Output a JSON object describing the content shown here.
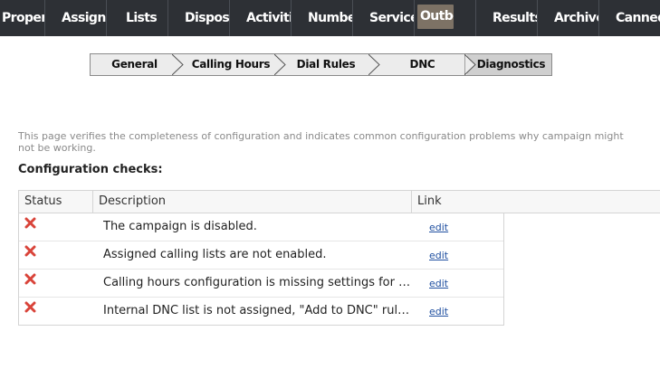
{
  "nav": {
    "tabs": [
      {
        "label": "Proper"
      },
      {
        "label": "Assignment"
      },
      {
        "label": "Lists"
      },
      {
        "label": "Dispositions"
      },
      {
        "label": "Activities"
      },
      {
        "label": "Numbers"
      },
      {
        "label": "Services"
      },
      {
        "label": "Outbound",
        "active": true
      },
      {
        "label": "Results"
      },
      {
        "label": "Archive"
      },
      {
        "label": "Canned"
      }
    ]
  },
  "wizard": {
    "steps": [
      {
        "label": "General"
      },
      {
        "label": "Calling Hours"
      },
      {
        "label": "Dial Rules"
      },
      {
        "label": "DNC"
      },
      {
        "label": "Diagnostics",
        "active": true
      }
    ]
  },
  "intro": "This page verifies the completeness of configuration and indicates common configuration problems why campaign might not be working.",
  "checks": {
    "title": "Configuration checks:",
    "columns": {
      "status": "Status",
      "description": "Description",
      "link": "Link"
    },
    "rows": [
      {
        "status": "error",
        "description": "The campaign is disabled.",
        "link": "edit"
      },
      {
        "status": "error",
        "description": "Assigned calling lists are not enabled.",
        "link": "edit"
      },
      {
        "status": "error",
        "description": "Calling hours configuration is missing settings for some days of the week.",
        "link": "edit"
      },
      {
        "status": "error",
        "description": "Internal DNC list is not assigned, \"Add to DNC\" rules will not work.",
        "link": "edit"
      }
    ]
  },
  "colors": {
    "nav_bg": "#2d3035",
    "nav_active": "#7d7265",
    "error_icon": "#d9443a",
    "link": "#1f4fa0"
  },
  "icons": {
    "status_error": "x-icon"
  }
}
